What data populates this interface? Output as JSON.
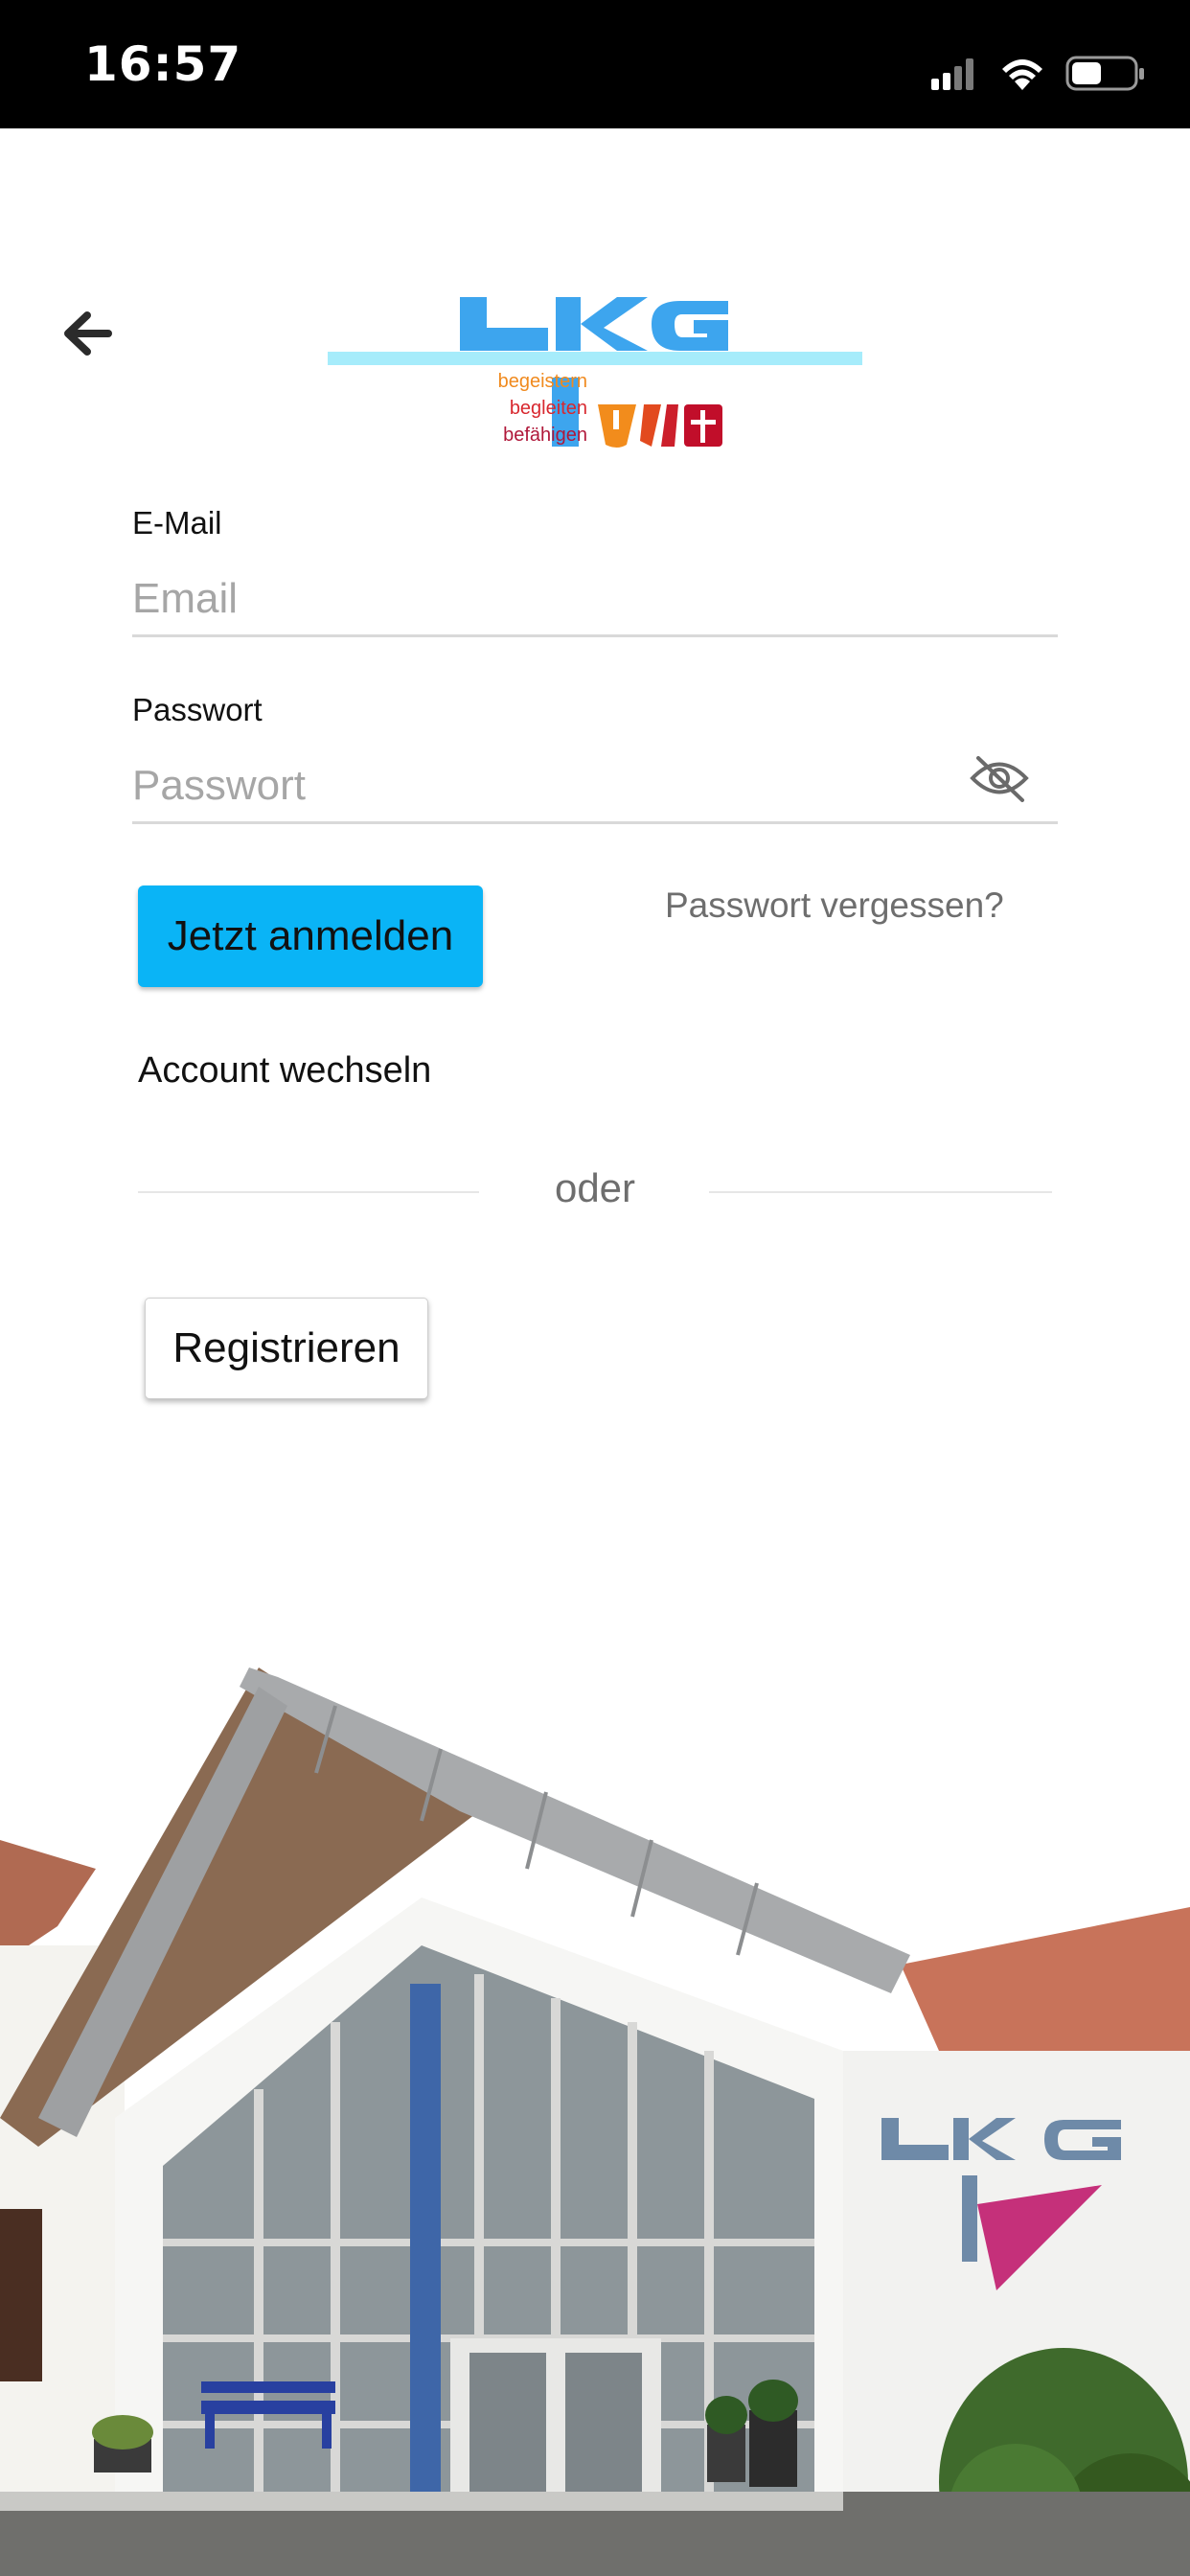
{
  "status_bar": {
    "time": "16:57",
    "icons": [
      "signal-icon",
      "wifi-icon",
      "battery-icon"
    ]
  },
  "navigation": {
    "back_icon": "arrow-left-icon"
  },
  "logo": {
    "text": "LKG",
    "tagline": [
      "begeistern",
      "begleiten",
      "befähigen"
    ]
  },
  "form": {
    "email": {
      "label": "E-Mail",
      "placeholder": "Email",
      "value": ""
    },
    "password": {
      "label": "Passwort",
      "placeholder": "Passwort",
      "value": "",
      "toggle_icon": "eye-off-icon"
    },
    "login_button": "Jetzt anmelden",
    "forgot_password": "Passwort vergessen?",
    "switch_account": "Account wechseln",
    "separator": "oder",
    "register_button": "Registrieren"
  },
  "colors": {
    "primary_button": "#0ab4f6",
    "logo_blue": "#3da5ee",
    "logo_cyan": "#a6ecfb",
    "tagline_orange": "#f08a1e",
    "tagline_red": "#d8282f",
    "tagline_dark_red": "#b0183a"
  }
}
